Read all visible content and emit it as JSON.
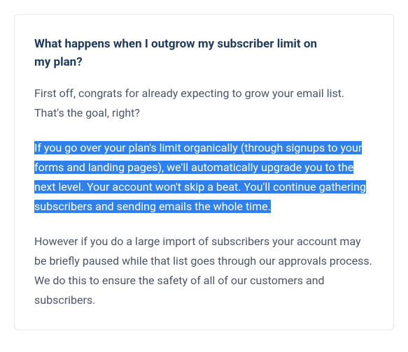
{
  "card": {
    "heading": "What happens when I outgrow my subscriber limit on my plan?",
    "para1": "First off, congrats for already expecting to grow your email list. That's the goal, right?",
    "para2": "If you go over your plan's limit organically (through signups to your forms and landing pages), we'll automatically upgrade you to the next level. Your account won't skip a beat. You'll continue gathering subscribers and sending emails the whole time.",
    "para3": "However if you do a large import of subscribers your account may be briefly paused while that list goes through our approvals process. We do this to ensure the safety of all of our customers and subscribers."
  }
}
